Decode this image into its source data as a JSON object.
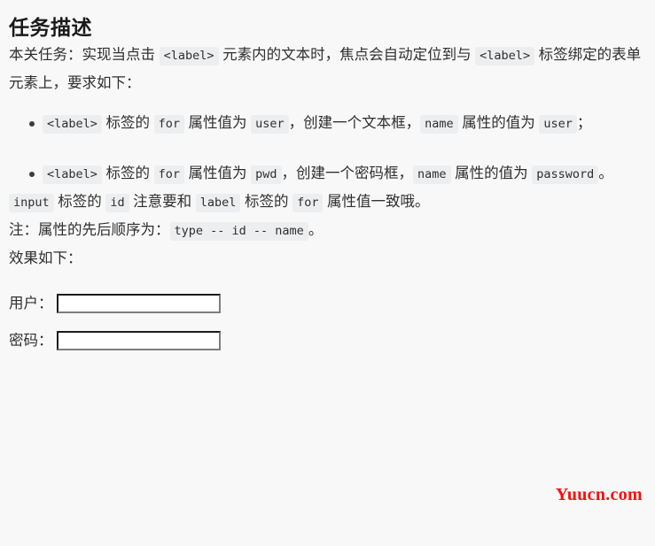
{
  "page": {
    "title": "任务描述",
    "background_color": "#f8f8f8",
    "text_color": "#2f2f2f"
  },
  "intro": {
    "seg1": "本关任务：实现当点击 ",
    "code1": "<label>",
    "seg2": " 元素内的文本时，焦点会自动定位到与 ",
    "code2": "<label>",
    "seg3": " 标签绑定的表单元素上，要求如下："
  },
  "requirements": [
    {
      "code1": "<label>",
      "seg1": " 标签的 ",
      "code2": "for",
      "seg2": " 属性值为 ",
      "code3": "user",
      "seg3": "，创建一个文本框，",
      "code4": "name",
      "seg4": " 属性的值为 ",
      "code5": "user",
      "seg5": "；"
    },
    {
      "code1": "<label>",
      "seg1": " 标签的 ",
      "code2": "for",
      "seg2": " 属性值为 ",
      "code3": "pwd",
      "seg3": "，创建一个密码框，",
      "code4": "name",
      "seg4": " 属性的值为 ",
      "code5": "password",
      "seg5": "。"
    }
  ],
  "note_id": {
    "code1": "input",
    "seg1": " 标签的 ",
    "code2": "id",
    "seg2": " 注意要和 ",
    "code3": "label",
    "seg3": " 标签的 ",
    "code4": "for",
    "seg4": " 属性值一致哦。"
  },
  "note_order": {
    "seg1": "注：属性的先后顺序为：",
    "code1": "type -- id -- name",
    "seg2": "。"
  },
  "effect": {
    "label": "效果如下："
  },
  "form": {
    "rows": [
      {
        "label": "用户：",
        "value": "",
        "placeholder": "",
        "type": "text",
        "name": "user"
      },
      {
        "label": "密码：",
        "value": "",
        "placeholder": "",
        "type": "password",
        "name": "password"
      }
    ]
  },
  "watermark": {
    "text": "Yuucn.com",
    "color": "#fb0d0d"
  }
}
